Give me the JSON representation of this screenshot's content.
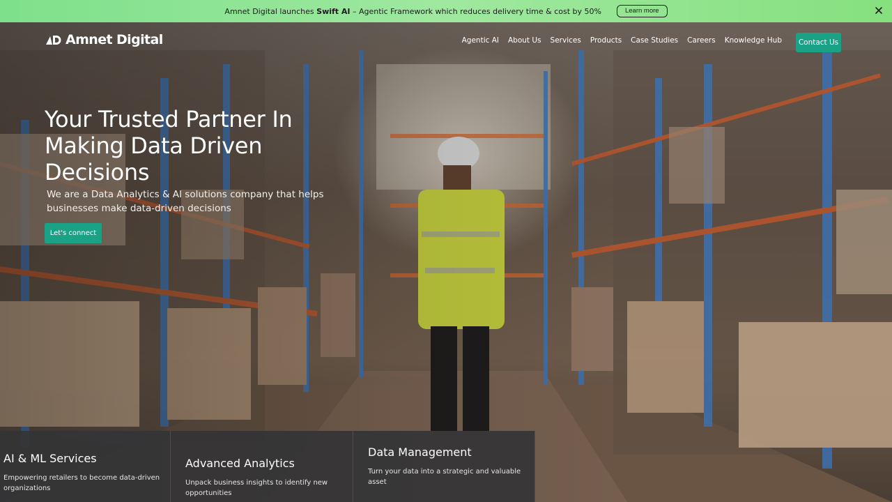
{
  "announcement": {
    "prefix": "Amnet Digital launches ",
    "highlight": "Swift AI",
    "suffix": " – Agentic Framework which reduces delivery time & cost by 50%",
    "button_label": "Learn more",
    "close_icon": "close-icon"
  },
  "brand": {
    "name": "Amnet Digital",
    "logo_icon": "amnet-logo-mark"
  },
  "nav": {
    "items": [
      "Agentic AI",
      "About Us",
      "Services",
      "Products",
      "Case Studies",
      "Careers",
      "Knowledge Hub"
    ],
    "cta_label": "Contact Us"
  },
  "hero": {
    "headline": "Your Trusted Partner In Making Data Driven Decisions",
    "subhead": "We are a Data Analytics & AI solutions company that helps businesses make data-driven decisions",
    "cta_label": "Let's connect"
  },
  "cards": [
    {
      "title": "AI & ML Services",
      "desc": "Empowering retailers to become data-driven organizations"
    },
    {
      "title": "Advanced Analytics",
      "desc": "Unpack business insights to identify new opportunities"
    },
    {
      "title": "Data Management",
      "desc": "Turn your data into a strategic and valuable asset"
    }
  ],
  "colors": {
    "accent": "#1aa287",
    "announcement_bg": "#86e07e",
    "card_bg": "#343436"
  }
}
